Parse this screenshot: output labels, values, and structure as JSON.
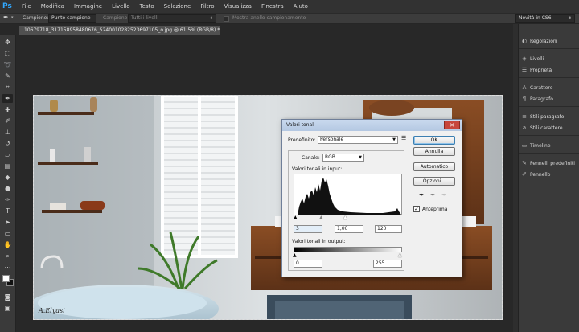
{
  "app": {
    "logo": "Ps"
  },
  "menu": [
    "File",
    "Modifica",
    "Immagine",
    "Livello",
    "Testo",
    "Selezione",
    "Filtro",
    "Visualizza",
    "Finestra",
    "Aiuto"
  ],
  "options_bar": {
    "sample_label": "Campione:",
    "sample_value": "Punto campione",
    "sample2_label": "Campione:",
    "sample2_value": "Tutti i livelli",
    "ring_label": "Mostra anello campionamento",
    "workspace_value": "Novità in CS6"
  },
  "document": {
    "tab_title": "10679718_317158958480676_5240010282523697105_o.jpg @ 61,5% (RGB/8) *",
    "signature": "A.Elyasi"
  },
  "panels": [
    {
      "icon": "adjust-icon",
      "label": "Regolazioni"
    },
    {
      "icon": "layers-icon",
      "label": "Livelli"
    },
    {
      "icon": "properties-icon",
      "label": "Proprietà"
    },
    {
      "icon": "character-icon",
      "label": "Carattere"
    },
    {
      "icon": "paragraph-icon",
      "label": "Paragrafo"
    },
    {
      "icon": "paragraph-styles-icon",
      "label": "Stili paragrafo"
    },
    {
      "icon": "character-styles-icon",
      "label": "Stili carattere"
    },
    {
      "icon": "timeline-icon",
      "label": "Timeline"
    },
    {
      "icon": "brush-presets-icon",
      "label": "Pennelli predefiniti"
    },
    {
      "icon": "brush-icon",
      "label": "Pennello"
    }
  ],
  "dialog": {
    "title": "Valori tonali",
    "preset_label": "Predefinito:",
    "preset_value": "Personale",
    "channel_label": "Canale:",
    "channel_value": "RGB",
    "input_label": "Valori tonali in input:",
    "input_black": "3",
    "input_gamma": "1,00",
    "input_white": "120",
    "output_label": "Valori tonali in output:",
    "output_black": "0",
    "output_white": "255",
    "ok": "OK",
    "cancel": "Annulla",
    "auto": "Automatico",
    "options": "Opzioni...",
    "preview": "Anteprima",
    "preview_checked": true
  }
}
